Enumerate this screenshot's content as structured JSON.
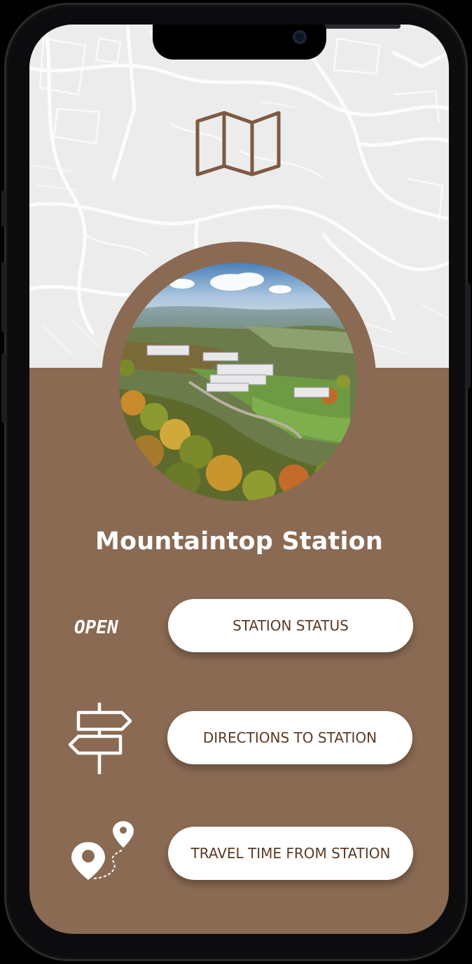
{
  "station": {
    "title": "Mountaintop Station",
    "status": "OPEN"
  },
  "actions": [
    {
      "label": "STATION STATUS",
      "icon": "status-text"
    },
    {
      "label": "DIRECTIONS TO STATION",
      "icon": "signpost-icon"
    },
    {
      "label": "TRAVEL TIME FROM STATION",
      "icon": "route-pins-icon"
    }
  ],
  "colors": {
    "brand_brown": "#8a6a52",
    "icon_brown": "#7d5a43",
    "button_text": "#5a3b24",
    "map_background": "#ececec"
  },
  "icons": {
    "header": "folded-map-icon",
    "photo": "aerial-campus-photo"
  }
}
